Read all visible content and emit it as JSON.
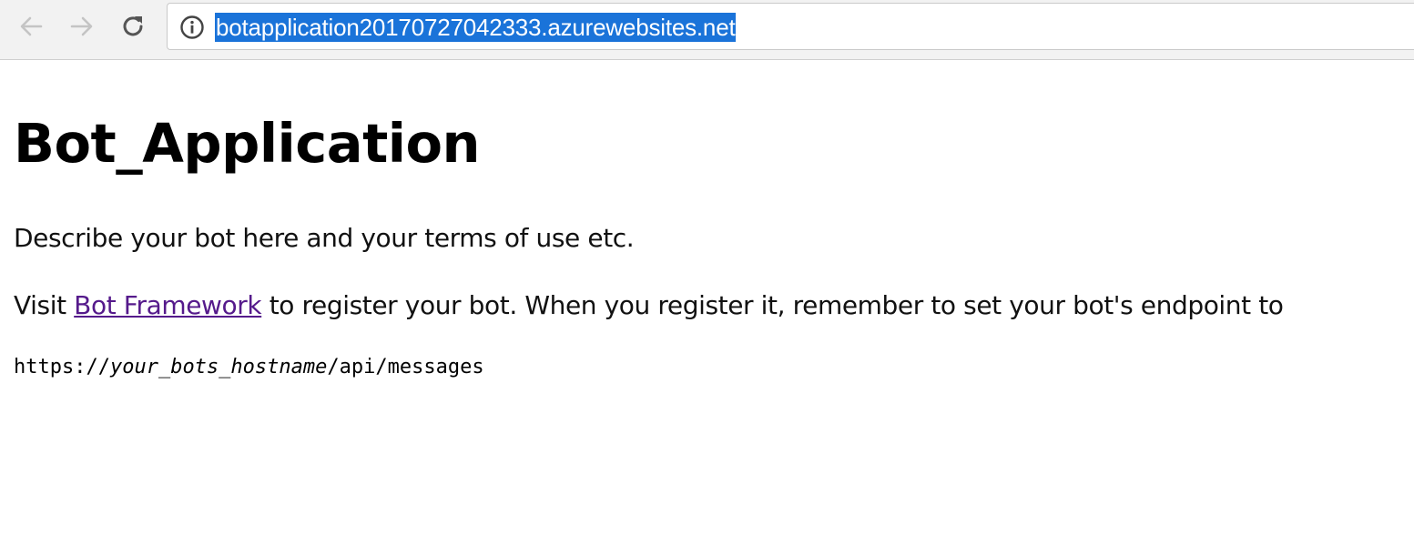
{
  "browser": {
    "url": "botapplication20170727042333.azurewebsites.net",
    "icons": {
      "back": "arrow-left-icon",
      "forward": "arrow-right-icon",
      "reload": "reload-icon",
      "site_info": "info-icon"
    },
    "colors": {
      "toolbar_bg": "#f2f2f2",
      "selection": "#1a73d9",
      "nav_disabled": "#c4c4c4",
      "nav_enabled": "#555555"
    }
  },
  "page": {
    "title": "Bot_Application",
    "description": "Describe your bot here and your terms of use etc.",
    "visit_prefix": "Visit ",
    "link_text": "Bot Framework",
    "visit_suffix": " to register your bot. When you register it, remember to set your bot's endpoint to",
    "endpoint_prefix": "https://",
    "endpoint_host": "your_bots_hostname",
    "endpoint_suffix": "/api/messages",
    "colors": {
      "link_visited": "#551a8b"
    }
  }
}
